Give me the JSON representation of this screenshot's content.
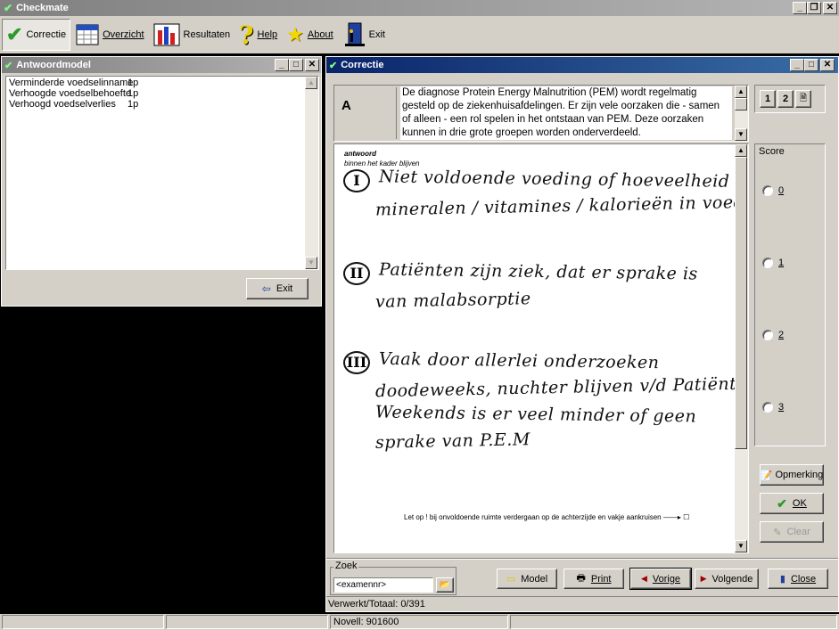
{
  "app": {
    "title": "Checkmate"
  },
  "toolbar": {
    "correctie": "Correctie",
    "overzicht": "Overzicht",
    "resultaten": "Resultaten",
    "help": "Help",
    "about": "About",
    "exit": "Exit"
  },
  "antwoordmodel": {
    "title": "Antwoordmodel",
    "items": [
      {
        "label": "Verminderde voedselinname",
        "points": "1p"
      },
      {
        "label": "Verhoogde voedselbehoefte",
        "points": "1p"
      },
      {
        "label": "Verhoogd voedselverlies",
        "points": "1p"
      }
    ],
    "exit_label": "Exit"
  },
  "correctie": {
    "title": "Correctie",
    "question_letter": "A",
    "question_text": "De diagnose Protein Energy Malnutrition (PEM) wordt regelmatig gesteld op de ziekenhuisafdelingen. Er zijn vele oorzaken die - samen of alleen - een rol spelen in het ontstaan van PEM. Deze oorzaken kunnen in drie grote groepen worden onderverdeeld.",
    "page_tabs": [
      "1",
      "2"
    ],
    "scan": {
      "header1": "antwoord",
      "header2": "binnen het kader blijven",
      "answers": [
        {
          "numeral": "I",
          "lines": [
            "Niet voldoende voeding of hoeveelheid",
            "mineralen / vitamines / kalorieën in voeding"
          ]
        },
        {
          "numeral": "II",
          "lines": [
            "Patiënten zijn ziek, dat er sprake is",
            "van malabsorptie"
          ]
        },
        {
          "numeral": "III",
          "lines": [
            "Vaak door allerlei onderzoeken",
            "doodeweeks, nuchter blijven v/d Patiënt.",
            "Weekends is er veel minder of geen",
            "sprake van P.E.M"
          ]
        }
      ],
      "footer": "Let op ! bij onvoldoende ruimte verdergaan op de achterzijde en vakje aankruisen"
    },
    "score": {
      "label": "Score",
      "options": [
        "0",
        "1",
        "2",
        "3"
      ]
    },
    "opmerking_label": "Opmerking",
    "ok_label": "OK",
    "clear_label": "Clear",
    "zoek": {
      "label": "Zoek",
      "value": "<examennr>"
    },
    "buttons": {
      "model": "Model",
      "print": "Print",
      "vorige": "Vorige",
      "volgende": "Volgende",
      "close": "Close"
    },
    "status": "Verwerkt/Totaal: 0/391"
  },
  "statusbar": {
    "novell": "Novell: 901600"
  }
}
